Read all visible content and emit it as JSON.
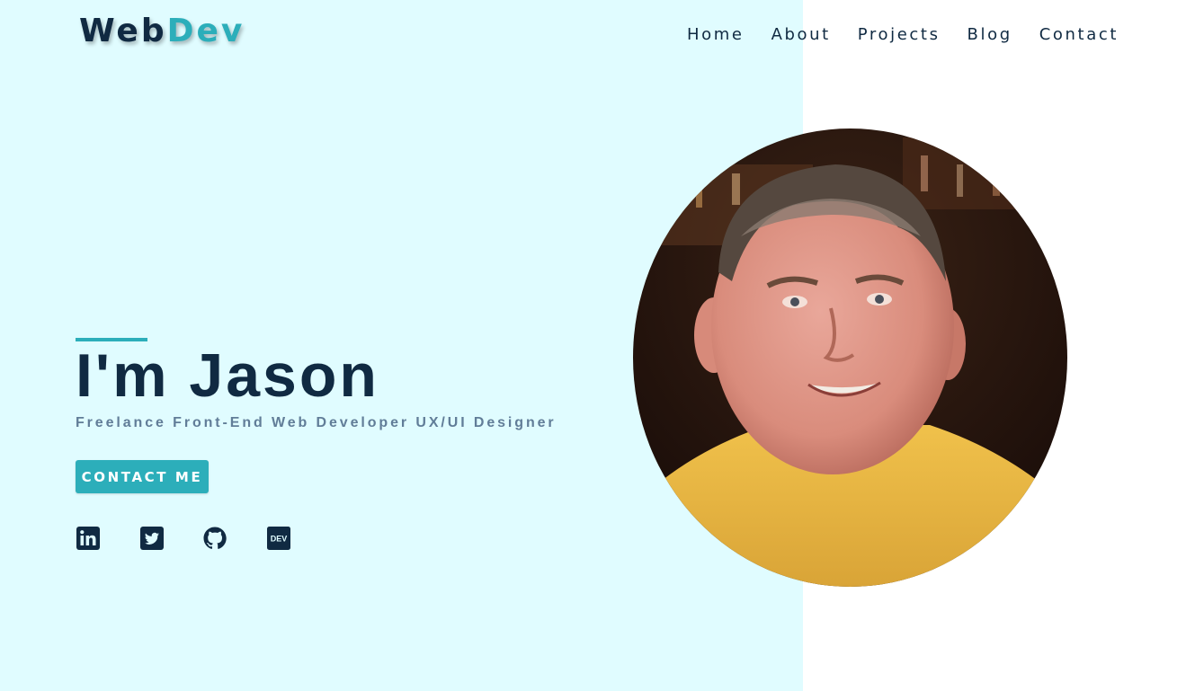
{
  "brand": {
    "part1": "Web",
    "part2": "Dev"
  },
  "nav": {
    "items": [
      {
        "label": "Home"
      },
      {
        "label": "About"
      },
      {
        "label": "Projects"
      },
      {
        "label": "Blog"
      },
      {
        "label": "Contact"
      }
    ]
  },
  "hero": {
    "title": "I'm Jason",
    "subtitle": "Freelance Front-End Web Developer UX/UI Designer",
    "cta_label": "CONTACT ME"
  },
  "social": [
    {
      "icon": "linkedin-icon"
    },
    {
      "icon": "twitter-icon"
    },
    {
      "icon": "github-icon"
    },
    {
      "icon": "dev-icon",
      "text": "DEV"
    }
  ],
  "portrait": {
    "subject": "portrait-photo"
  },
  "colors": {
    "accent": "#2caeba",
    "dark": "#102a42",
    "muted": "#617d98",
    "hero_bg": "#e0fcff",
    "page_bg": "#ffffff"
  }
}
